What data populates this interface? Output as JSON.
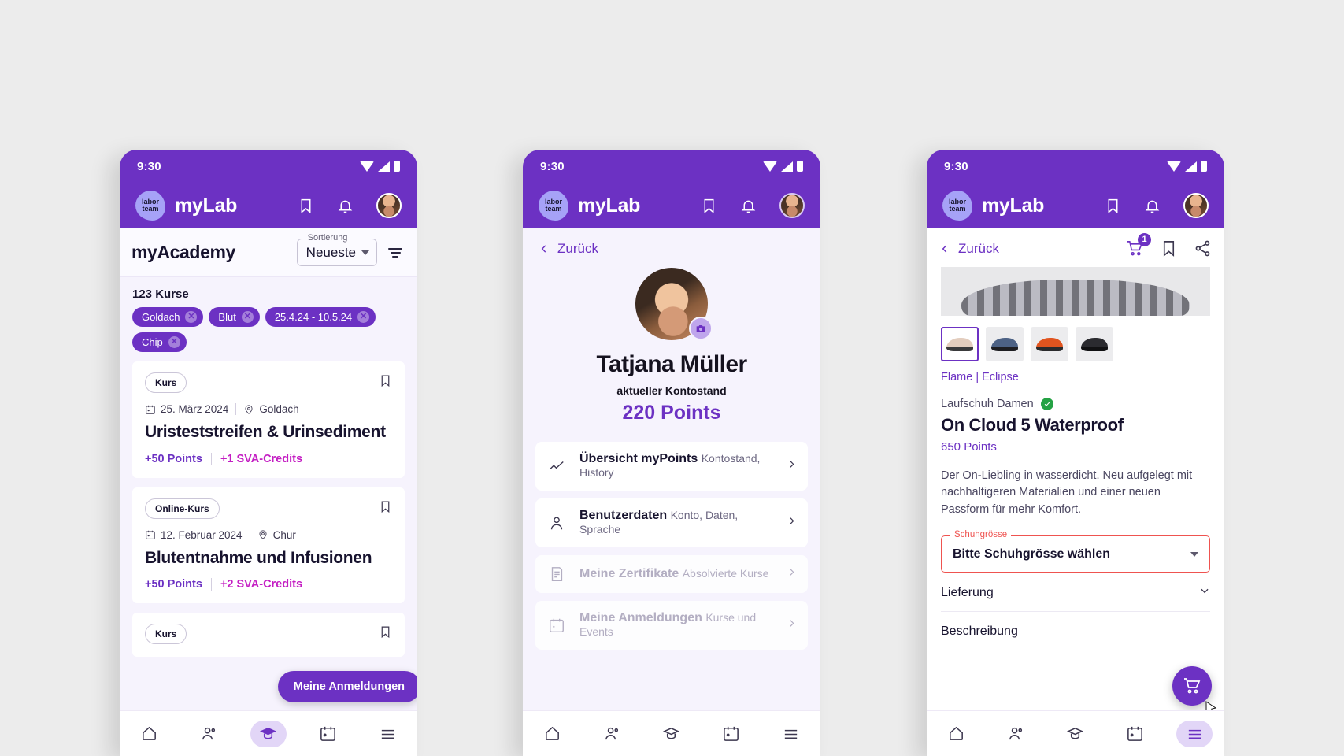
{
  "brand": {
    "name": "myLab",
    "logo_line1": "labor",
    "logo_line2": "team"
  },
  "status": {
    "time": "9:30"
  },
  "phone1": {
    "page_title": "myAcademy",
    "sort": {
      "label": "Sortierung",
      "value": "Neueste"
    },
    "filter_icon": "filter-icon",
    "count": "123 Kurse",
    "chips": [
      "Goldach",
      "Blut",
      "25.4.24 - 10.5.24",
      "Chip"
    ],
    "cards": [
      {
        "type": "Kurs",
        "date": "25. März 2024",
        "location": "Goldach",
        "title": "Uristeststreifen & Urinsediment",
        "points": "+50 Points",
        "credits": "+1 SVA-Credits"
      },
      {
        "type": "Online-Kurs",
        "date": "12. Februar 2024",
        "location": "Chur",
        "title": "Blutentnahme und Infusionen",
        "points": "+50 Points",
        "credits": "+2 SVA-Credits"
      },
      {
        "type": "Kurs",
        "date": "",
        "location": "",
        "title": "",
        "points": "",
        "credits": ""
      }
    ],
    "fab_label": "Meine Anmeldungen"
  },
  "phone2": {
    "back_label": "Zurück",
    "profile_name": "Tatjana Müller",
    "balance_label": "aktueller Kontostand",
    "balance_value": "220 Points",
    "menu": [
      {
        "icon": "chart-line-icon",
        "title": "Übersicht myPoints",
        "subtitle": "Kontostand, History",
        "disabled": false
      },
      {
        "icon": "person-icon",
        "title": "Benutzerdaten",
        "subtitle": "Konto, Daten, Sprache",
        "disabled": false
      },
      {
        "icon": "certificate-icon",
        "title": "Meine Zertifikate",
        "subtitle": "Absolvierte Kurse",
        "disabled": true
      },
      {
        "icon": "calendar-icon",
        "title": "Meine Anmeldungen",
        "subtitle": "Kurse und Events",
        "disabled": true
      }
    ]
  },
  "phone3": {
    "back_label": "Zurück",
    "cart_badge": "1",
    "color_name": "Flame | Eclipse",
    "category": "Laufschuh Damen",
    "product_title": "On Cloud 5 Waterproof",
    "price": "650 Points",
    "description": "Der On-Liebling in wasserdicht. Neu aufgelegt mit nachhaltigeren Materialien und einer neuen Passform für mehr Komfort.",
    "size_legend": "Schuhgrösse",
    "size_value": "Bitte Schuhgrösse wählen",
    "accordions": [
      "Lieferung",
      "Beschreibung"
    ]
  },
  "colors": {
    "primary": "#6c31c3",
    "accent_pink": "#c41ec3",
    "error": "#ef5350",
    "verified_green": "#25a244",
    "page_bg": "#ececec"
  }
}
